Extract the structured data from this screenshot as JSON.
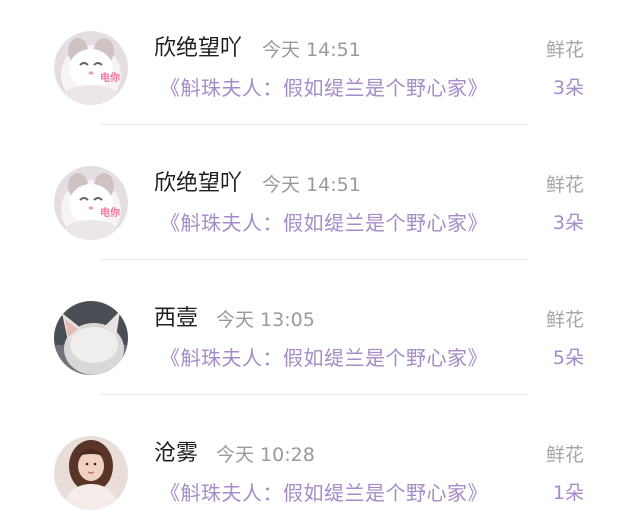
{
  "feed": {
    "items": [
      {
        "avatar": "cat-avatar",
        "avatar_tag": "电你",
        "name": "欣绝望吖",
        "time": "今天 14:51",
        "title": "《斛珠夫人：假如缇兰是个野心家》",
        "gift_label": "鲜花",
        "gift_count": "3朵"
      },
      {
        "avatar": "cat-avatar",
        "avatar_tag": "电你",
        "name": "欣绝望吖",
        "time": "今天 14:51",
        "title": "《斛珠夫人：假如缇兰是个野心家》",
        "gift_label": "鲜花",
        "gift_count": "3朵"
      },
      {
        "avatar": "white-cat-avatar",
        "name": "西壹",
        "time": "今天 13:05",
        "title": "《斛珠夫人：假如缇兰是个野心家》",
        "gift_label": "鲜花",
        "gift_count": "5朵"
      },
      {
        "avatar": "woman-portrait-avatar",
        "name": "沧雾",
        "time": "今天 10:28",
        "title": "《斛珠夫人：假如缇兰是个野心家》",
        "gift_label": "鲜花",
        "gift_count": "1朵"
      }
    ]
  },
  "colors": {
    "accent_purple": "#a58bc8",
    "name_text": "#1f1f1f",
    "meta_gray": "#9a9a9a",
    "avatar_tag_pink": "#f07aa0"
  }
}
